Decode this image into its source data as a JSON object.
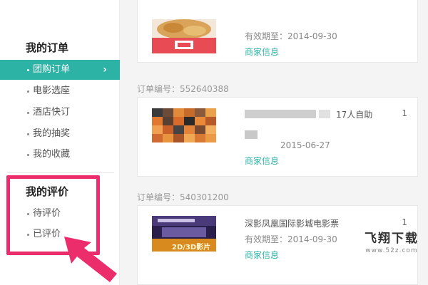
{
  "sidebar": {
    "orders_heading": "我的订单",
    "order_items": [
      {
        "label": "团购订单",
        "active": true
      },
      {
        "label": "电影选座",
        "active": false
      },
      {
        "label": "酒店快订",
        "active": false
      },
      {
        "label": "我的抽奖",
        "active": false
      },
      {
        "label": "我的收藏",
        "active": false
      }
    ],
    "reviews_heading": "我的评价",
    "review_items": [
      {
        "label": "待评价"
      },
      {
        "label": "已评价"
      }
    ],
    "active_chevron": "›"
  },
  "orders": [
    {
      "number_label": "",
      "title": "",
      "validity": "有效期至：2014-09-30",
      "merchant_link": "商家信息",
      "quantity": ""
    },
    {
      "number_label": "订单编号：552640388",
      "title": "17人自助",
      "validity": "2015-06-27",
      "merchant_link": "商家信息",
      "quantity": "1"
    },
    {
      "number_label": "订单编号：540301200",
      "title": "深影凤凰国际影城电影票",
      "validity": "有效期至：2014-09-30",
      "merchant_link": "商家信息",
      "quantity": "1"
    }
  ],
  "thumb3_caption": "2D/3D影片",
  "watermark": {
    "main": "飞翔下载",
    "url": "www.52z.com"
  },
  "colors": {
    "accent": "#2db3a6",
    "highlight": "#ec2d6c"
  }
}
